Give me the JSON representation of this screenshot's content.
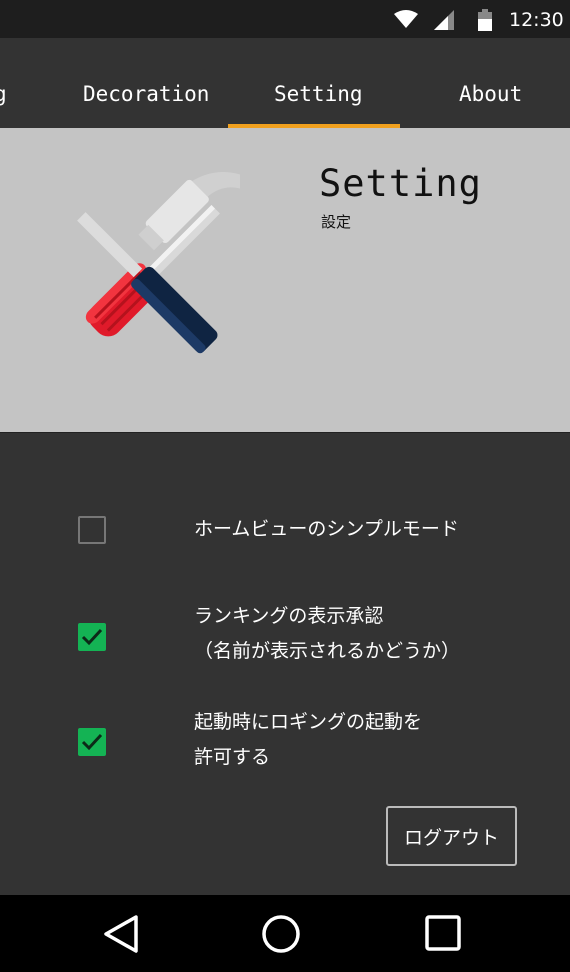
{
  "status_bar": {
    "time": "12:30",
    "icons": [
      "wifi-icon",
      "signal-icon",
      "battery-icon"
    ]
  },
  "tabs": [
    {
      "label": "g",
      "selected": false
    },
    {
      "label": "Decoration",
      "selected": false
    },
    {
      "label": "Setting",
      "selected": true
    },
    {
      "label": "About",
      "selected": false
    }
  ],
  "header": {
    "title": "Setting",
    "subtitle": "設定",
    "illustration": "hammer-screwdriver-icon"
  },
  "settings": [
    {
      "label_lines": [
        "ホームビューのシンプルモード"
      ],
      "checked": false
    },
    {
      "label_lines": [
        "ランキングの表示承認",
        "（名前が表示されるかどうか）"
      ],
      "checked": true
    },
    {
      "label_lines": [
        "起動時にロギングの起動を",
        "許可する"
      ],
      "checked": true
    }
  ],
  "logout_label": "ログアウト",
  "nav_bar": {
    "icons": [
      "back-icon",
      "home-icon",
      "recents-icon"
    ]
  },
  "colors": {
    "accent": "#f0a01e",
    "checkbox_checked": "#14b354",
    "background": "#333333",
    "header_bg": "#c4c4c4"
  }
}
